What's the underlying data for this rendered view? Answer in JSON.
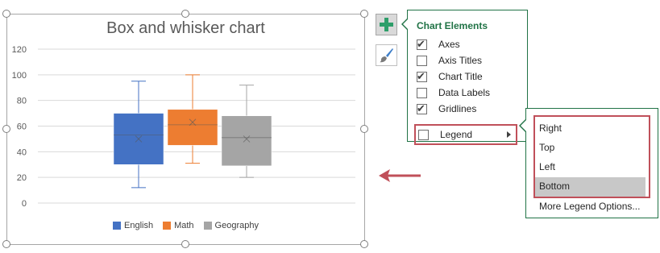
{
  "chart": {
    "title": "Box and whisker chart",
    "legend_position": "bottom"
  },
  "chart_data": {
    "type": "box",
    "title": "Box and whisker chart",
    "ylim": [
      0,
      120
    ],
    "yticks": [
      0,
      20,
      40,
      60,
      80,
      100,
      120
    ],
    "grid": true,
    "legend": "bottom",
    "series": [
      {
        "name": "English",
        "color": "#4472c4",
        "min": 12,
        "q1": 30,
        "median": 53,
        "q3": 70,
        "max": 95,
        "mean": 50
      },
      {
        "name": "Math",
        "color": "#ed7d31",
        "min": 31,
        "q1": 45,
        "median": 61,
        "q3": 73,
        "max": 100,
        "mean": 63
      },
      {
        "name": "Geography",
        "color": "#a5a5a5",
        "min": 20,
        "q1": 29,
        "median": 51,
        "q3": 68,
        "max": 92,
        "mean": 50
      }
    ]
  },
  "side_buttons": {
    "plus_icon": "plus-icon",
    "brush_icon": "paintbrush-icon",
    "accent_color": "#217346"
  },
  "elements_panel": {
    "title": "Chart Elements",
    "items": [
      {
        "label": "Axes",
        "checked": true
      },
      {
        "label": "Axis Titles",
        "checked": false
      },
      {
        "label": "Chart Title",
        "checked": true
      },
      {
        "label": "Data Labels",
        "checked": false
      },
      {
        "label": "Gridlines",
        "checked": true
      },
      {
        "label": "Legend",
        "checked": false
      }
    ]
  },
  "legend_submenu": {
    "items": [
      "Right",
      "Top",
      "Left",
      "Bottom"
    ],
    "selected": "Bottom",
    "more": "More Legend Options..."
  },
  "highlight_color": "#c0505a"
}
